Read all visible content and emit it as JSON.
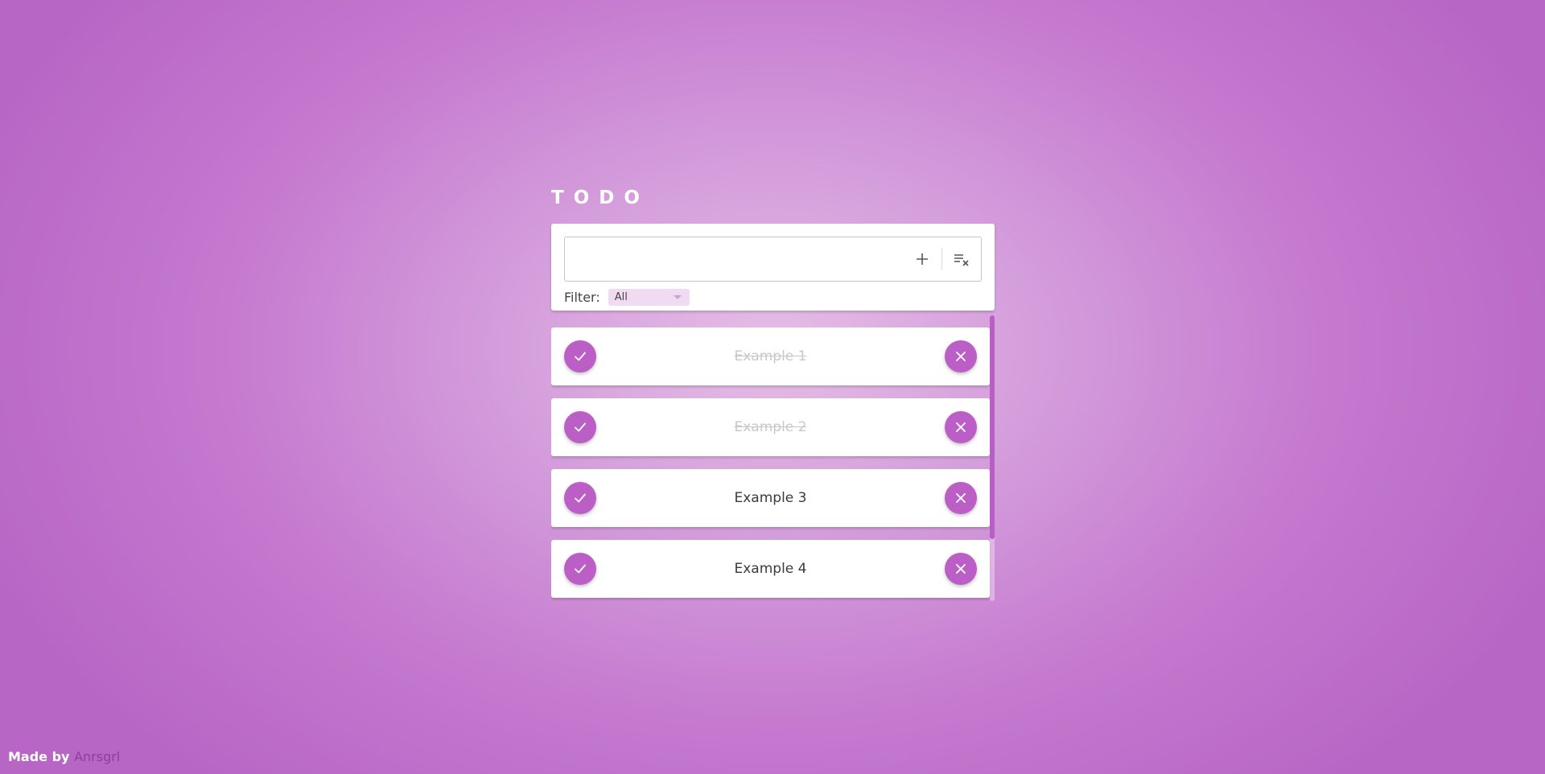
{
  "app": {
    "title": "TODO"
  },
  "input": {
    "value": "",
    "placeholder": ""
  },
  "toolbar": {
    "add_icon": "plus-icon",
    "clear_icon": "clear-list-icon"
  },
  "filter": {
    "label": "Filter:",
    "selected": "All"
  },
  "todos": [
    {
      "text": "Example 1",
      "completed": true
    },
    {
      "text": "Example 2",
      "completed": true
    },
    {
      "text": "Example 3",
      "completed": false
    },
    {
      "text": "Example 4",
      "completed": false
    }
  ],
  "footer": {
    "prefix": "Made by",
    "author": "Anrsgrl"
  },
  "colors": {
    "accent": "#bb5fc6",
    "background": "#c579cf",
    "completed_text": "#c8c8c8"
  }
}
